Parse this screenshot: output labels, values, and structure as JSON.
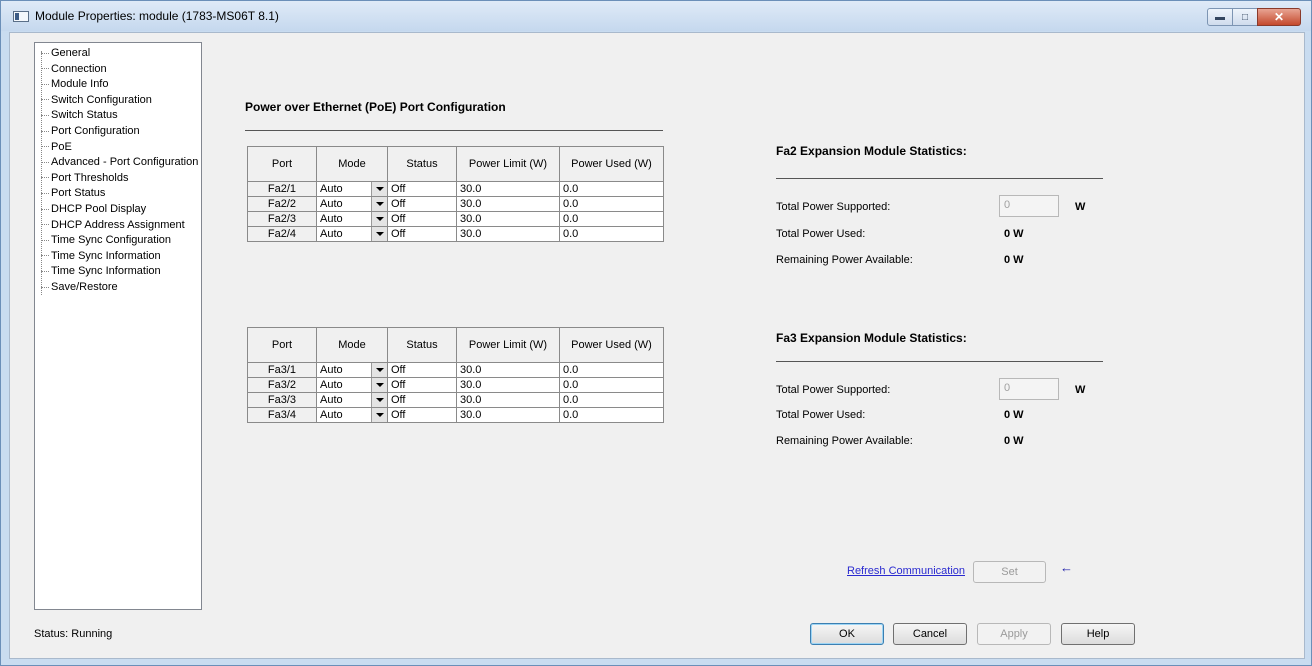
{
  "window": {
    "title": "Module Properties: module (1783-MS06T 8.1)"
  },
  "tree": {
    "items": [
      "General",
      "Connection",
      "Module Info",
      "Switch Configuration",
      "Switch Status",
      "Port Configuration",
      "PoE",
      "Advanced - Port Configuration",
      "Port Thresholds",
      "Port Status",
      "DHCP Pool Display",
      "DHCP Address Assignment",
      "Time Sync Configuration",
      "Time Sync Information",
      "Time Sync Information",
      "Save/Restore"
    ]
  },
  "status": "Status:  Running",
  "poe": {
    "title": "Power over Ethernet (PoE) Port Configuration",
    "headers": [
      "Port",
      "Mode",
      "Status",
      "Power Limit (W)",
      "Power Used (W)"
    ],
    "table1": [
      {
        "port": "Fa2/1",
        "mode": "Auto",
        "status": "Off",
        "limit": "30.0",
        "used": "0.0"
      },
      {
        "port": "Fa2/2",
        "mode": "Auto",
        "status": "Off",
        "limit": "30.0",
        "used": "0.0"
      },
      {
        "port": "Fa2/3",
        "mode": "Auto",
        "status": "Off",
        "limit": "30.0",
        "used": "0.0"
      },
      {
        "port": "Fa2/4",
        "mode": "Auto",
        "status": "Off",
        "limit": "30.0",
        "used": "0.0"
      }
    ],
    "table2": [
      {
        "port": "Fa3/1",
        "mode": "Auto",
        "status": "Off",
        "limit": "30.0",
        "used": "0.0"
      },
      {
        "port": "Fa3/2",
        "mode": "Auto",
        "status": "Off",
        "limit": "30.0",
        "used": "0.0"
      },
      {
        "port": "Fa3/3",
        "mode": "Auto",
        "status": "Off",
        "limit": "30.0",
        "used": "0.0"
      },
      {
        "port": "Fa3/4",
        "mode": "Auto",
        "status": "Off",
        "limit": "30.0",
        "used": "0.0"
      }
    ]
  },
  "fa2": {
    "title": "Fa2 Expansion Module Statistics:",
    "total_supported_label": "Total Power Supported:",
    "total_supported_value": "0",
    "unit": "W",
    "total_used_label": "Total Power Used:",
    "total_used_value": "0 W",
    "remaining_label": "Remaining Power Available:",
    "remaining_value": "0 W"
  },
  "fa3": {
    "title": "Fa3 Expansion Module Statistics:",
    "total_supported_label": "Total Power Supported:",
    "total_supported_value": "0",
    "unit": "W",
    "total_used_label": "Total Power Used:",
    "total_used_value": "0 W",
    "remaining_label": "Remaining Power Available:",
    "remaining_value": "0 W"
  },
  "actions": {
    "refresh": "Refresh Communication",
    "set": "Set",
    "ok": "OK",
    "cancel": "Cancel",
    "apply": "Apply",
    "help": "Help"
  }
}
